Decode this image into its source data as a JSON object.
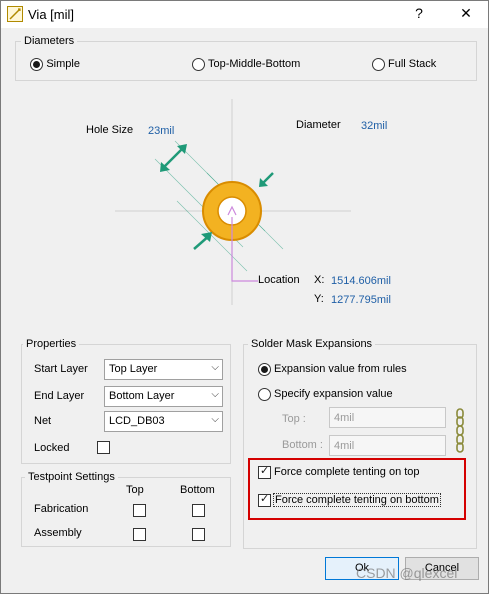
{
  "window": {
    "title": "Via [mil]",
    "help_label": "?",
    "close_label": "✕"
  },
  "diameters": {
    "title": "Diameters",
    "options": [
      "Simple",
      "Top-Middle-Bottom",
      "Full Stack"
    ],
    "selected": "Simple"
  },
  "drawing": {
    "hole_size_label": "Hole Size",
    "hole_size_value": "23mil",
    "diameter_label": "Diameter",
    "diameter_value": "32mil",
    "location_label": "Location",
    "x_label": "X:",
    "x_value": "1514.606mil",
    "y_label": "Y:",
    "y_value": "1277.795mil",
    "colors": {
      "pad": "#f3b221",
      "pad_edge": "#d98c00",
      "hole": "#ffffff",
      "arrow": "#1f9a78",
      "guide": "#cc88dd",
      "axis": "#cfcfcf"
    }
  },
  "properties": {
    "title": "Properties",
    "start_layer_label": "Start Layer",
    "start_layer_value": "Top Layer",
    "end_layer_label": "End Layer",
    "end_layer_value": "Bottom Layer",
    "net_label": "Net",
    "net_value": "LCD_DB03",
    "locked_label": "Locked"
  },
  "testpoint": {
    "title": "Testpoint Settings",
    "col_top": "Top",
    "col_bottom": "Bottom",
    "row_fabrication": "Fabrication",
    "row_assembly": "Assembly"
  },
  "solder_mask": {
    "title": "Solder Mask Expansions",
    "option_rules": "Expansion value from rules",
    "option_specify": "Specify expansion value",
    "top_label": "Top :",
    "top_value": "4mil",
    "bottom_label": "Bottom :",
    "bottom_value": "4mil",
    "force_top_label": "Force complete tenting on top",
    "force_bottom_label": "Force complete tenting on bottom",
    "highlight_color": "#d40000"
  },
  "buttons": {
    "ok": "Ok",
    "cancel": "Cancel"
  },
  "watermark": "CSDN @qlexcel"
}
